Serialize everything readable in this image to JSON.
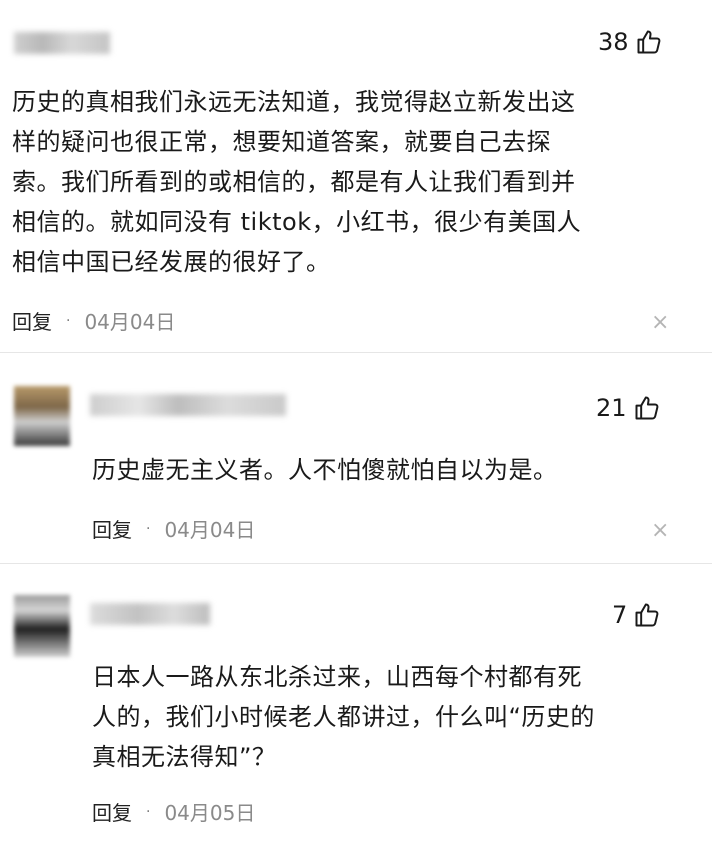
{
  "comments": [
    {
      "likes": "38",
      "lines": [
        "历史的真相我们永远无法知道，我觉得赵立新发出这",
        "样的疑问也很正常，想要知道答案，就要自己去探",
        "索。我们所看到的或相信的，都是有人让我们看到并",
        "相信的。就如同没有 tiktok，小红书，很少有美国人",
        "相信中国已经发展的很好了。"
      ],
      "reply_label": "回复",
      "separator": "·",
      "date": "04月04日",
      "close_glyph": "×"
    },
    {
      "likes": "21",
      "lines": [
        "历史虚无主义者。人不怕傻就怕自以为是。"
      ],
      "reply_label": "回复",
      "separator": "·",
      "date": "04月04日",
      "close_glyph": "×"
    },
    {
      "likes": "7",
      "lines": [
        "日本人一路从东北杀过来，山西每个村都有死",
        "人的，我们小时候老人都讲过，什么叫“历史的",
        "真相无法得知”？"
      ],
      "reply_label": "回复",
      "separator": "·",
      "date": "04月05日",
      "close_glyph": "×"
    }
  ]
}
